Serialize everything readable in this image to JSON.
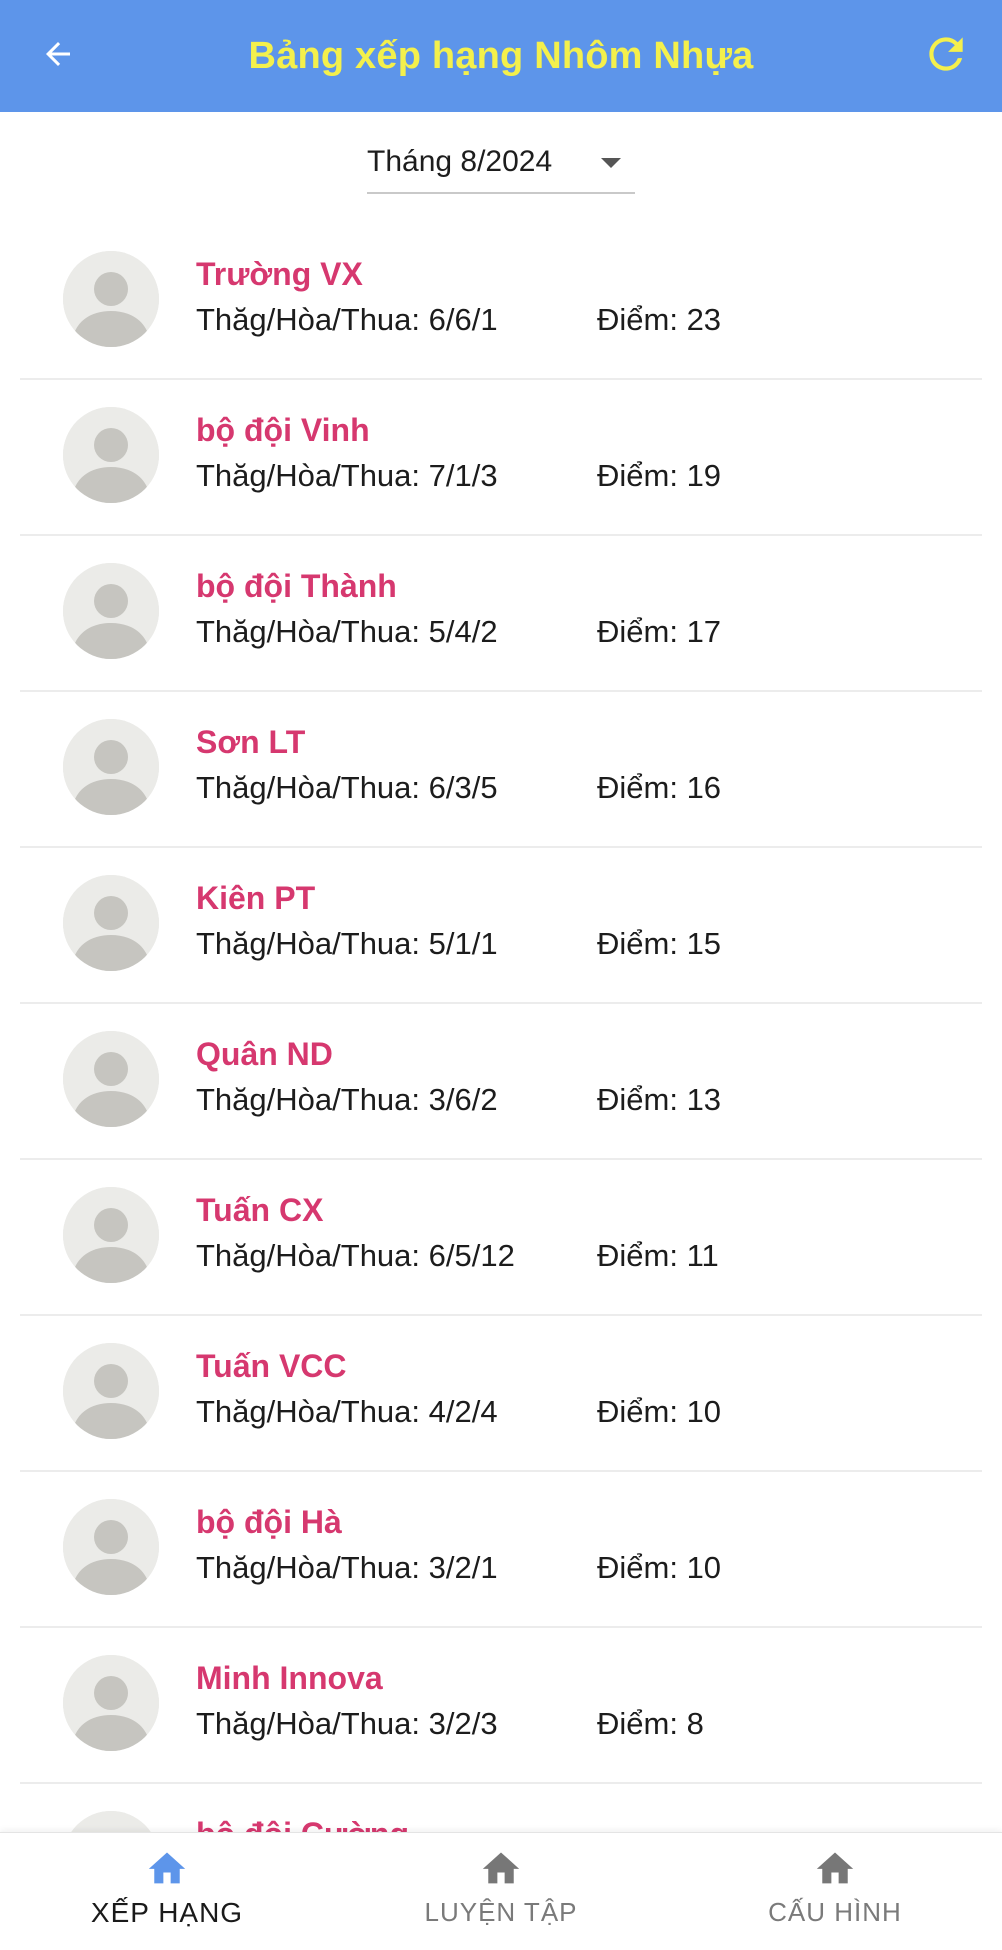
{
  "appbar": {
    "title": "Bảng xếp hạng Nhôm Nhựa",
    "back_icon": "arrow-back-icon",
    "refresh_icon": "refresh-icon",
    "bg_color": "#5d95ea",
    "title_color": "#f4f04c"
  },
  "month_select": {
    "value": "Tháng 8/2024",
    "caret_icon": "caret-down-icon"
  },
  "players": [
    {
      "name": "Trường VX",
      "record": "Thăg/Hòa/Thua: 6/6/1",
      "points": "Điểm: 23"
    },
    {
      "name": "bộ đội Vinh",
      "record": "Thăg/Hòa/Thua: 7/1/3",
      "points": "Điểm: 19"
    },
    {
      "name": "bộ đội Thành",
      "record": "Thăg/Hòa/Thua: 5/4/2",
      "points": "Điểm: 17"
    },
    {
      "name": "Sơn LT",
      "record": "Thăg/Hòa/Thua: 6/3/5",
      "points": "Điểm: 16"
    },
    {
      "name": "Kiên PT",
      "record": "Thăg/Hòa/Thua: 5/1/1",
      "points": "Điểm: 15"
    },
    {
      "name": "Quân ND",
      "record": "Thăg/Hòa/Thua: 3/6/2",
      "points": "Điểm: 13"
    },
    {
      "name": "Tuấn CX",
      "record": "Thăg/Hòa/Thua: 6/5/12",
      "points": "Điểm: 11"
    },
    {
      "name": "Tuấn VCC",
      "record": "Thăg/Hòa/Thua: 4/2/4",
      "points": "Điểm: 10"
    },
    {
      "name": "bộ đội Hà",
      "record": "Thăg/Hòa/Thua: 3/2/1",
      "points": "Điểm: 10"
    },
    {
      "name": "Minh Innova",
      "record": "Thăg/Hòa/Thua: 3/2/3",
      "points": "Điểm: 8"
    },
    {
      "name": "bộ đội Cường",
      "record": "",
      "points": ""
    }
  ],
  "nav": [
    {
      "label": "XẾP HẠNG",
      "icon": "home-icon",
      "active": true
    },
    {
      "label": "LUYỆN TẬP",
      "icon": "home-icon",
      "active": false
    },
    {
      "label": "CẤU HÌNH",
      "icon": "home-icon",
      "active": false
    }
  ],
  "colors": {
    "name": "#d6386f",
    "nav_active": "#5d95ea",
    "nav_inactive": "#777777"
  }
}
